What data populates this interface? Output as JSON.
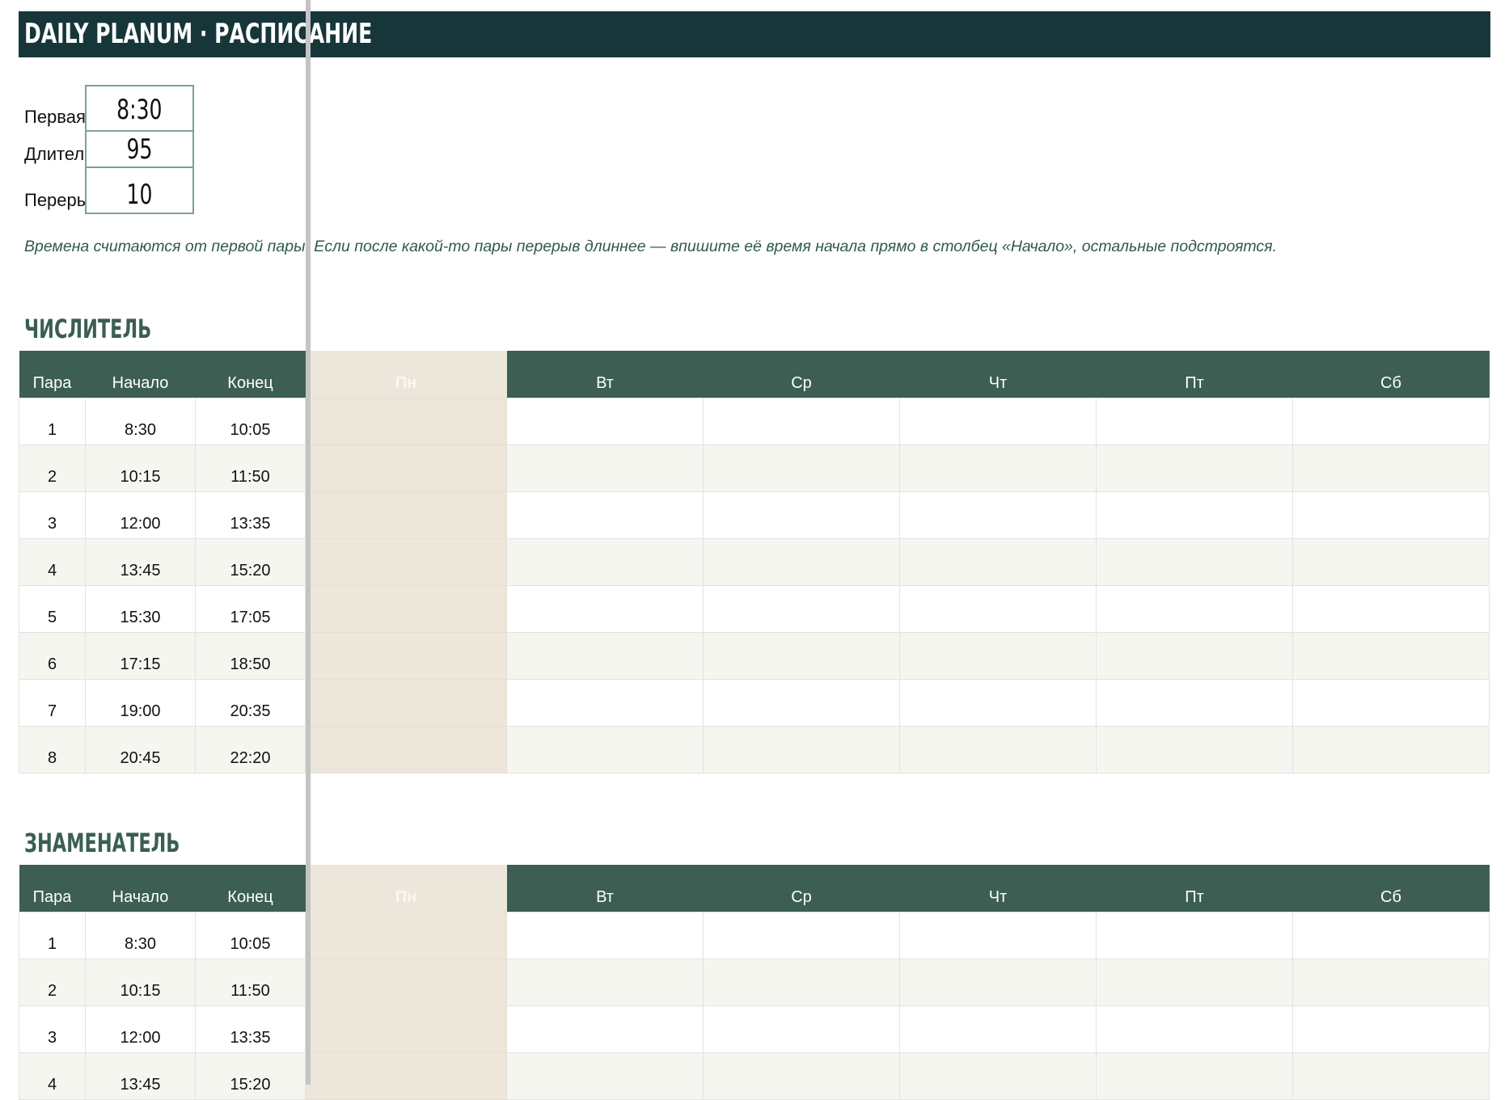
{
  "app": {
    "title": "DAILY PLANUM · РАСПИСАНИЕ"
  },
  "params": [
    {
      "label": "Первая",
      "value": "8:30"
    },
    {
      "label": "Длител",
      "value": "95"
    },
    {
      "label": "Переры",
      "value": "10"
    }
  ],
  "note": "Времена считаются от первой пары. Если после какой-то пары перерыв длиннее — впишите её время начала прямо в столбец «Начало», остальные подстроятся.",
  "columns": [
    "Пара",
    "Начало",
    "Конец",
    "Пн",
    "Вт",
    "Ср",
    "Чт",
    "Пт",
    "Сб"
  ],
  "sections": [
    {
      "title": "ЧИСЛИТЕЛЬ",
      "rows": [
        {
          "n": "1",
          "start": "8:30",
          "end": "10:05"
        },
        {
          "n": "2",
          "start": "10:15",
          "end": "11:50"
        },
        {
          "n": "3",
          "start": "12:00",
          "end": "13:35"
        },
        {
          "n": "4",
          "start": "13:45",
          "end": "15:20"
        },
        {
          "n": "5",
          "start": "15:30",
          "end": "17:05"
        },
        {
          "n": "6",
          "start": "17:15",
          "end": "18:50"
        },
        {
          "n": "7",
          "start": "19:00",
          "end": "20:35"
        },
        {
          "n": "8",
          "start": "20:45",
          "end": "22:20"
        }
      ]
    },
    {
      "title": "ЗНАМЕНАТЕЛЬ",
      "rows": [
        {
          "n": "1",
          "start": "8:30",
          "end": "10:05"
        },
        {
          "n": "2",
          "start": "10:15",
          "end": "11:50"
        },
        {
          "n": "3",
          "start": "12:00",
          "end": "13:35"
        },
        {
          "n": "4",
          "start": "13:45",
          "end": "15:20"
        }
      ]
    }
  ],
  "colors": {
    "title_bar": "#17363a",
    "header": "#3c5e53",
    "monday_highlight": "#ede6da",
    "param_border": "#7aa38e",
    "note_text": "#2f5a4c"
  }
}
